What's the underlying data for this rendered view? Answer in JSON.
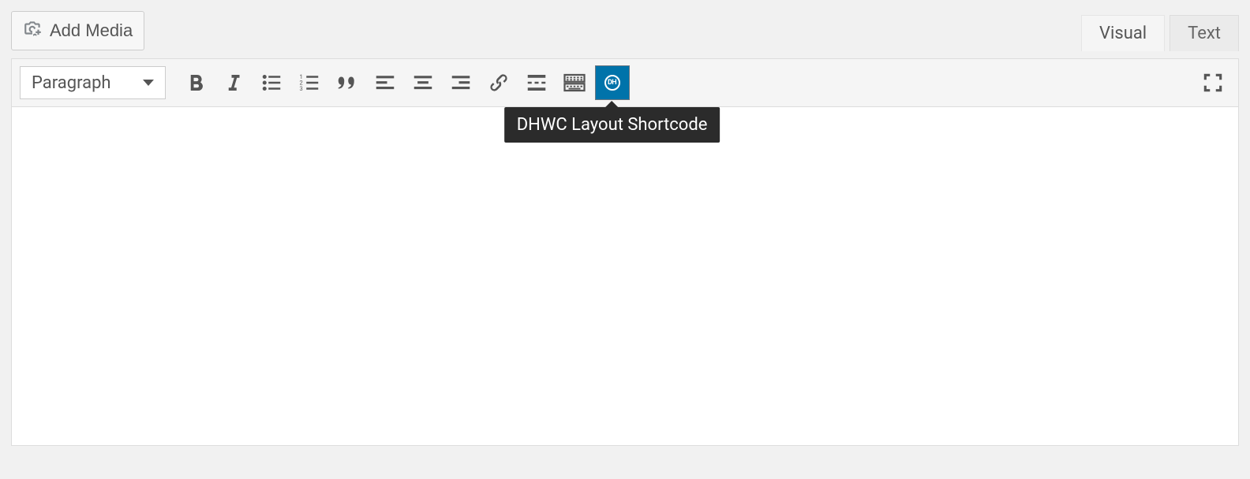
{
  "topbar": {
    "add_media_label": "Add Media"
  },
  "tabs": {
    "visual": "Visual",
    "text": "Text"
  },
  "toolbar": {
    "format_select": "Paragraph",
    "dhwc_badge": "DH"
  },
  "tooltip": {
    "dhwc": "DHWC Layout Shortcode"
  }
}
